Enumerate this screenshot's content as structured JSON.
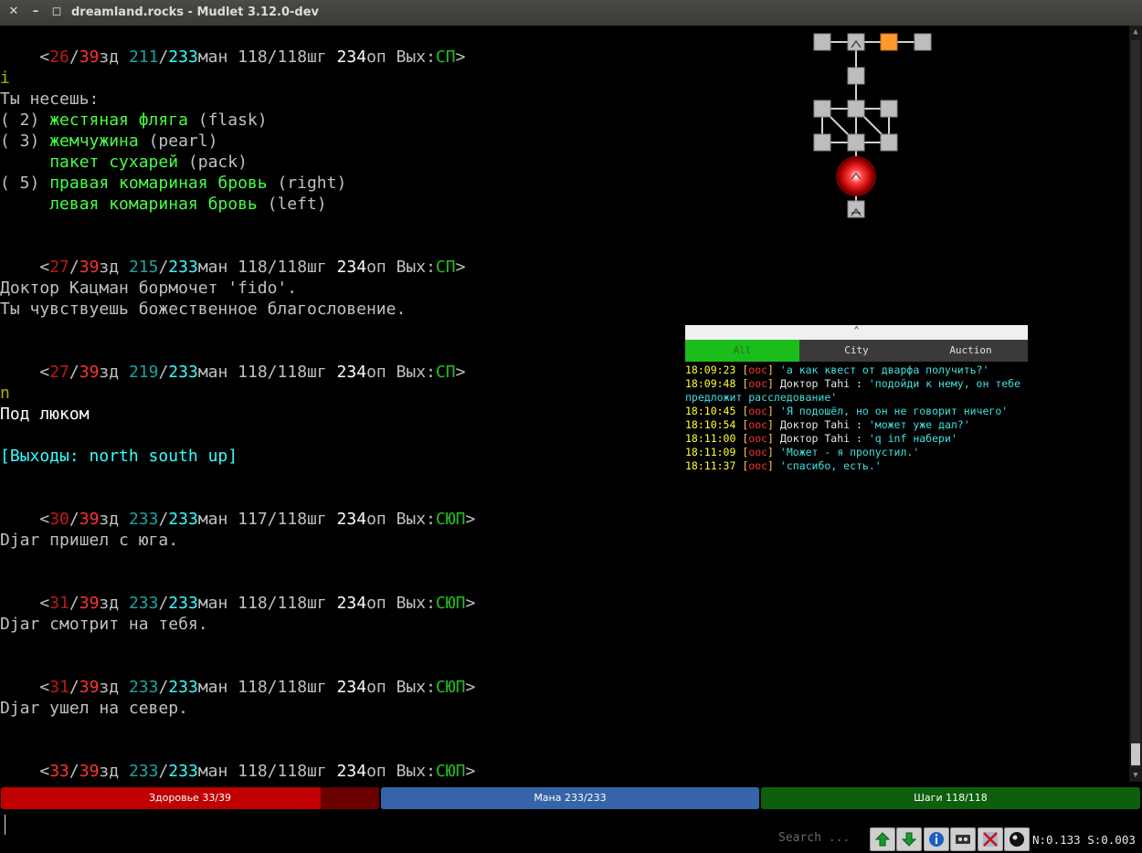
{
  "window": {
    "title": "dreamland.rocks - Mudlet 3.12.0-dev",
    "close_glyph": "✕",
    "minimize_glyph": "–",
    "maximize_glyph": "◻"
  },
  "prompts": {
    "p1": {
      "lt": "<",
      "hp": "26",
      "slash": "/",
      "hpmax": "39",
      "hp_label": "зд ",
      "mana": "211",
      "manamax": "233",
      "mana_label": "ман ",
      "mv": "118/118",
      "mv_label": "шг ",
      "exp": "234",
      "exp_label": "оп Вых:",
      "exits": "СП",
      "gt": ">"
    },
    "p2": {
      "lt": "<",
      "hp": "27",
      "slash": "/",
      "hpmax": "39",
      "hp_label": "зд ",
      "mana": "215",
      "manamax": "233",
      "mana_label": "ман ",
      "mv": "118/118",
      "mv_label": "шг ",
      "exp": "234",
      "exp_label": "оп Вых:",
      "exits": "СП",
      "gt": ">"
    },
    "p3": {
      "lt": "<",
      "hp": "27",
      "slash": "/",
      "hpmax": "39",
      "hp_label": "зд ",
      "mana": "219",
      "manamax": "233",
      "mana_label": "ман ",
      "mv": "118/118",
      "mv_label": "шг ",
      "exp": "234",
      "exp_label": "оп Вых:",
      "exits": "СП",
      "gt": ">"
    },
    "p4": {
      "lt": "<",
      "hp": "30",
      "slash": "/",
      "hpmax": "39",
      "hp_label": "зд ",
      "mana": "233",
      "manamax": "233",
      "mana_label": "ман ",
      "mv": "117/118",
      "mv_label": "шг ",
      "exp": "234",
      "exp_label": "оп Вых:",
      "exits": "СЮП",
      "gt": ">"
    },
    "p5": {
      "lt": "<",
      "hp": "31",
      "slash": "/",
      "hpmax": "39",
      "hp_label": "зд ",
      "mana": "233",
      "manamax": "233",
      "mana_label": "ман ",
      "mv": "118/118",
      "mv_label": "шг ",
      "exp": "234",
      "exp_label": "оп Вых:",
      "exits": "СЮП",
      "gt": ">"
    },
    "p6": {
      "lt": "<",
      "hp": "31",
      "slash": "/",
      "hpmax": "39",
      "hp_label": "зд ",
      "mana": "233",
      "manamax": "233",
      "mana_label": "ман ",
      "mv": "118/118",
      "mv_label": "шг ",
      "exp": "234",
      "exp_label": "оп Вых:",
      "exits": "СЮП",
      "gt": ">"
    },
    "p7": {
      "lt": "<",
      "hp": "33",
      "slash": "/",
      "hpmax": "39",
      "hp_label": "зд ",
      "mana": "233",
      "manamax": "233",
      "mana_label": "ман ",
      "mv": "118/118",
      "mv_label": "шг ",
      "exp": "234",
      "exp_label": "оп Вых:",
      "exits": "СЮП",
      "gt": ">"
    }
  },
  "console": {
    "cmd_i": "i",
    "carrying": "Ты несешь:",
    "inventory": [
      {
        "count": "( 2) ",
        "name": "жестяная фляга",
        "alias": " (flask)"
      },
      {
        "count": "( 3) ",
        "name": "жемчужина",
        "alias": " (pearl)"
      },
      {
        "count": "     ",
        "name": "пакет сухарей",
        "alias": " (pack)"
      },
      {
        "count": "( 5) ",
        "name": "правая комариная бровь",
        "alias": " (right)"
      },
      {
        "count": "     ",
        "name": "левая комариная бровь",
        "alias": " (left)"
      }
    ],
    "doctor_mutter": "Доктор Кацман бормочет 'fido'.",
    "blessing": "Ты чувствуешь божественное благословение.",
    "cmd_n": "n",
    "room_name": "Под люком",
    "exits_line": "[Выходы: north south up]",
    "djar_arrive": "Djar пришел с юга.",
    "djar_look": "Djar смотрит на тебя.",
    "djar_leave": "Djar ушел на север."
  },
  "chat": {
    "collapse_glyph": "⌃",
    "tabs": [
      {
        "label": "All"
      },
      {
        "label": "City"
      },
      {
        "label": "Auction"
      }
    ],
    "messages": [
      {
        "time": "18:09:23",
        "channel": "ooc",
        "speaker": "",
        "text": "'а как квест от дварфа получить?'"
      },
      {
        "time": "18:09:48",
        "channel": "ooc",
        "speaker": "Доктор Tahi : ",
        "text": "'подойди к нему, он тебе"
      },
      {
        "time": "",
        "channel": "",
        "speaker": "",
        "text": "предложит расследование'"
      },
      {
        "time": "18:10:45",
        "channel": "ooc",
        "speaker": "",
        "text": "'Я подошёл, но он не говорит ничего'"
      },
      {
        "time": "18:10:54",
        "channel": "ooc",
        "speaker": "Доктор Tahi : ",
        "text": "'может уже дал?'"
      },
      {
        "time": "18:11:00",
        "channel": "ooc",
        "speaker": "Доктор Tahi : ",
        "text": "'q inf набери'"
      },
      {
        "time": "18:11:09",
        "channel": "ooc",
        "speaker": "",
        "text": "'Может - я пропустил.'"
      },
      {
        "time": "18:11:37",
        "channel": "ooc",
        "speaker": "",
        "text": "'спасибо, есть.'"
      }
    ]
  },
  "gauges": {
    "health": {
      "label": "Здоровье 33/39",
      "fraction": 0.846,
      "color": "#c00000",
      "bg": "#6a0000"
    },
    "mana": {
      "label": "Мана 233/233",
      "fraction": 1.0,
      "color": "#3565a8",
      "bg": "#1c3a66"
    },
    "moves": {
      "label": "Шаги 118/118",
      "fraction": 1.0,
      "color": "#0d5f0d",
      "bg": "#063006"
    }
  },
  "cmdline": {
    "search_placeholder": "Search ...",
    "netstat": "N:0.133 S:0.003"
  },
  "toolbar_icons": [
    "scroll-up-icon",
    "scroll-down-icon",
    "info-icon",
    "replay-icon",
    "timestamp-toggle-icon",
    "logging-icon"
  ]
}
